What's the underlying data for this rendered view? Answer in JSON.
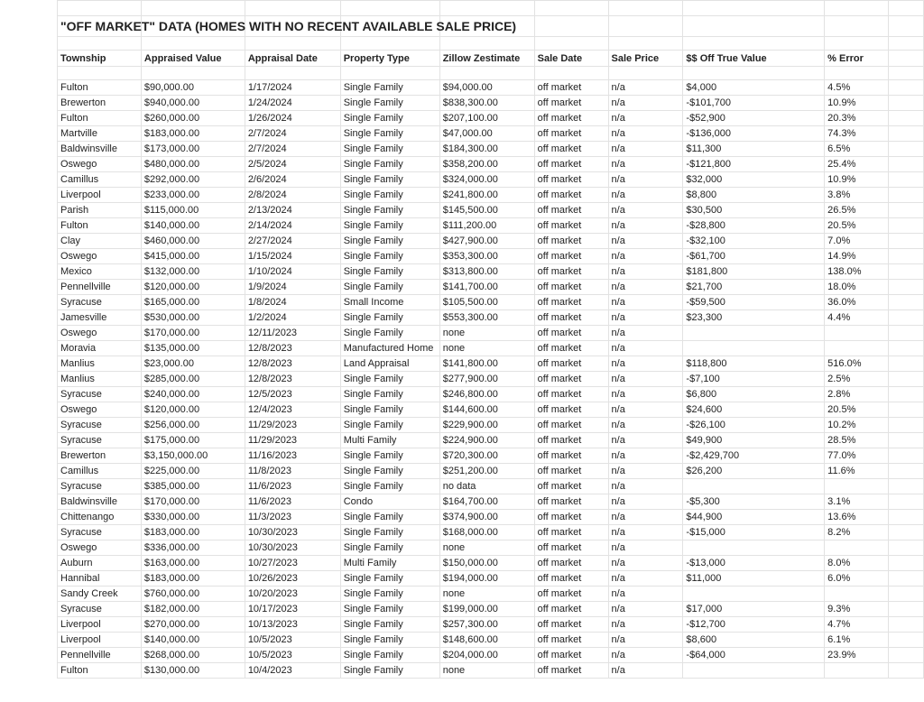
{
  "title": "\"OFF MARKET\" DATA (HOMES WITH NO RECENT AVAILABLE SALE PRICE)",
  "headers": [
    "Township",
    "Appraised Value",
    "Appraisal Date",
    "Property Type",
    "Zillow Zestimate",
    "Sale Date",
    "Sale Price",
    "$$ Off True Value",
    "% Error"
  ],
  "rows": [
    [
      "Fulton",
      "$90,000.00",
      "1/17/2024",
      "Single Family",
      "$94,000.00",
      "off market",
      "n/a",
      "$4,000",
      "4.5%"
    ],
    [
      "Brewerton",
      "$940,000.00",
      "1/24/2024",
      "Single Family",
      "$838,300.00",
      "off market",
      "n/a",
      "-$101,700",
      "10.9%"
    ],
    [
      "Fulton",
      "$260,000.00",
      "1/26/2024",
      "Single Family",
      "$207,100.00",
      "off market",
      "n/a",
      "-$52,900",
      "20.3%"
    ],
    [
      "Martville",
      "$183,000.00",
      "2/7/2024",
      "Single Family",
      "$47,000.00",
      "off market",
      "n/a",
      "-$136,000",
      "74.3%"
    ],
    [
      "Baldwinsville",
      "$173,000.00",
      "2/7/2024",
      "Single Family",
      "$184,300.00",
      "off market",
      "n/a",
      "$11,300",
      "6.5%"
    ],
    [
      "Oswego",
      "$480,000.00",
      "2/5/2024",
      "Single Family",
      "$358,200.00",
      "off market",
      "n/a",
      "-$121,800",
      "25.4%"
    ],
    [
      "Camillus",
      "$292,000.00",
      "2/6/2024",
      "Single Family",
      "$324,000.00",
      "off market",
      "n/a",
      "$32,000",
      "10.9%"
    ],
    [
      "Liverpool",
      "$233,000.00",
      "2/8/2024",
      "Single Family",
      "$241,800.00",
      "off market",
      "n/a",
      "$8,800",
      "3.8%"
    ],
    [
      "Parish",
      "$115,000.00",
      "2/13/2024",
      "Single Family",
      "$145,500.00",
      "off market",
      "n/a",
      "$30,500",
      "26.5%"
    ],
    [
      "Fulton",
      "$140,000.00",
      "2/14/2024",
      "Single Family",
      "$111,200.00",
      "off market",
      "n/a",
      "-$28,800",
      "20.5%"
    ],
    [
      "Clay",
      "$460,000.00",
      "2/27/2024",
      "Single Family",
      "$427,900.00",
      "off market",
      "n/a",
      "-$32,100",
      "7.0%"
    ],
    [
      "Oswego",
      "$415,000.00",
      "1/15/2024",
      "Single Family",
      "$353,300.00",
      "off market",
      "n/a",
      "-$61,700",
      "14.9%"
    ],
    [
      "Mexico",
      "$132,000.00",
      "1/10/2024",
      "Single Family",
      "$313,800.00",
      "off market",
      "n/a",
      "$181,800",
      "138.0%"
    ],
    [
      "Pennellville",
      "$120,000.00",
      "1/9/2024",
      "Single Family",
      "$141,700.00",
      "off market",
      "n/a",
      "$21,700",
      "18.0%"
    ],
    [
      "Syracuse",
      "$165,000.00",
      "1/8/2024",
      "Small Income",
      "$105,500.00",
      "off market",
      "n/a",
      "-$59,500",
      "36.0%"
    ],
    [
      "Jamesville",
      "$530,000.00",
      "1/2/2024",
      "Single Family",
      "$553,300.00",
      "off market",
      "n/a",
      "$23,300",
      "4.4%"
    ],
    [
      "Oswego",
      "$170,000.00",
      "12/11/2023",
      "Single Family",
      "none",
      "off market",
      "n/a",
      "",
      ""
    ],
    [
      "Moravia",
      "$135,000.00",
      "12/8/2023",
      "Manufactured Home",
      "none",
      "off market",
      "n/a",
      "",
      ""
    ],
    [
      "Manlius",
      "$23,000.00",
      "12/8/2023",
      "Land Appraisal",
      "$141,800.00",
      "off market",
      "n/a",
      "$118,800",
      "516.0%"
    ],
    [
      "Manlius",
      "$285,000.00",
      "12/8/2023",
      "Single Family",
      "$277,900.00",
      "off market",
      "n/a",
      "-$7,100",
      "2.5%"
    ],
    [
      "Syracuse",
      "$240,000.00",
      "12/5/2023",
      "Single Family",
      "$246,800.00",
      "off market",
      "n/a",
      "$6,800",
      "2.8%"
    ],
    [
      "Oswego",
      "$120,000.00",
      "12/4/2023",
      "Single Family",
      "$144,600.00",
      "off market",
      "n/a",
      "$24,600",
      "20.5%"
    ],
    [
      "Syracuse",
      "$256,000.00",
      "11/29/2023",
      "Single Family",
      "$229,900.00",
      "off market",
      "n/a",
      "-$26,100",
      "10.2%"
    ],
    [
      "Syracuse",
      "$175,000.00",
      "11/29/2023",
      "Multi Family",
      "$224,900.00",
      "off market",
      "n/a",
      "$49,900",
      "28.5%"
    ],
    [
      "Brewerton",
      "$3,150,000.00",
      "11/16/2023",
      "Single Family",
      "$720,300.00",
      "off market",
      "n/a",
      "-$2,429,700",
      "77.0%"
    ],
    [
      "Camillus",
      "$225,000.00",
      "11/8/2023",
      "Single Family",
      "$251,200.00",
      "off market",
      "n/a",
      "$26,200",
      "11.6%"
    ],
    [
      "Syracuse",
      "$385,000.00",
      "11/6/2023",
      "Single Family",
      "no data",
      "off market",
      "n/a",
      "",
      ""
    ],
    [
      "Baldwinsville",
      "$170,000.00",
      "11/6/2023",
      "Condo",
      "$164,700.00",
      "off market",
      "n/a",
      "-$5,300",
      "3.1%"
    ],
    [
      "Chittenango",
      "$330,000.00",
      "11/3/2023",
      "Single Family",
      "$374,900.00",
      "off market",
      "n/a",
      "$44,900",
      "13.6%"
    ],
    [
      "Syracuse",
      "$183,000.00",
      "10/30/2023",
      "Single Family",
      "$168,000.00",
      "off market",
      "n/a",
      "-$15,000",
      "8.2%"
    ],
    [
      "Oswego",
      "$336,000.00",
      "10/30/2023",
      "Single Family",
      "none",
      "off market",
      "n/a",
      "",
      ""
    ],
    [
      "Auburn",
      "$163,000.00",
      "10/27/2023",
      "Multi Family",
      "$150,000.00",
      "off market",
      "n/a",
      "-$13,000",
      "8.0%"
    ],
    [
      "Hannibal",
      "$183,000.00",
      "10/26/2023",
      "Single Family",
      "$194,000.00",
      "off market",
      "n/a",
      "$11,000",
      "6.0%"
    ],
    [
      "Sandy Creek",
      "$760,000.00",
      "10/20/2023",
      "Single Family",
      "none",
      "off market",
      "n/a",
      "",
      ""
    ],
    [
      "Syracuse",
      "$182,000.00",
      "10/17/2023",
      "Single Family",
      "$199,000.00",
      "off market",
      "n/a",
      "$17,000",
      "9.3%"
    ],
    [
      "Liverpool",
      "$270,000.00",
      "10/13/2023",
      "Single Family",
      "$257,300.00",
      "off market",
      "n/a",
      "-$12,700",
      "4.7%"
    ],
    [
      "Liverpool",
      "$140,000.00",
      "10/5/2023",
      "Single Family",
      "$148,600.00",
      "off market",
      "n/a",
      "$8,600",
      "6.1%"
    ],
    [
      "Pennellville",
      "$268,000.00",
      "10/5/2023",
      "Single Family",
      "$204,000.00",
      "off market",
      "n/a",
      "-$64,000",
      "23.9%"
    ],
    [
      "Fulton",
      "$130,000.00",
      "10/4/2023",
      "Single Family",
      "none",
      "off market",
      "n/a",
      "",
      ""
    ]
  ]
}
